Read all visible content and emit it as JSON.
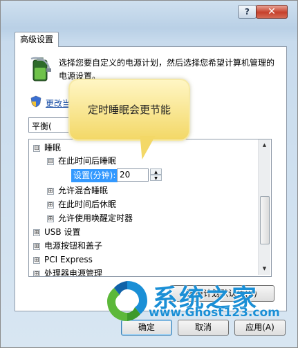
{
  "window": {
    "help_label": "?",
    "close_label": "✕"
  },
  "tab": {
    "label": "高级设置"
  },
  "intro": {
    "description": "选择您要自定义的电源计划，然后选择您希望计算机管理的电源设置。",
    "change_link": "更改当"
  },
  "plan_select": {
    "value": "平衡(",
    "arrow": "▼"
  },
  "tooltip": {
    "text": "定时睡眠会更节能"
  },
  "tree": {
    "items": [
      {
        "toggle": "⊟",
        "label": "睡眠",
        "level": 0
      },
      {
        "toggle": "⊟",
        "label": "在此时间后睡眠",
        "level": 1
      },
      {
        "toggle": "⊞",
        "label": "允许混合睡眠",
        "level": 1
      },
      {
        "toggle": "⊞",
        "label": "在此时间后休眠",
        "level": 1
      },
      {
        "toggle": "⊞",
        "label": "允许使用唤醒定时器",
        "level": 1
      },
      {
        "toggle": "⊞",
        "label": "USB 设置",
        "level": 0
      },
      {
        "toggle": "⊞",
        "label": "电源按钮和盖子",
        "level": 0
      },
      {
        "toggle": "⊞",
        "label": "PCI Express",
        "level": 0
      },
      {
        "toggle": "⊞",
        "label": "处理器电源管理",
        "level": 0
      }
    ],
    "setting_label": "设置(分钟):",
    "setting_value": "20"
  },
  "scrollbar": {
    "up": "▲",
    "down": "▼"
  },
  "buttons": {
    "restore": "还原计划默认值(R)",
    "ok": "确定",
    "cancel": "取消",
    "apply": "应用(A)"
  },
  "watermark": {
    "name": "系统之家",
    "url": "www.Ghost123.com"
  },
  "colors": {
    "accent": "#3399ff",
    "link": "#1a4fa6",
    "watermark": "#1a8fd6",
    "tooltip": "#f3d867"
  }
}
